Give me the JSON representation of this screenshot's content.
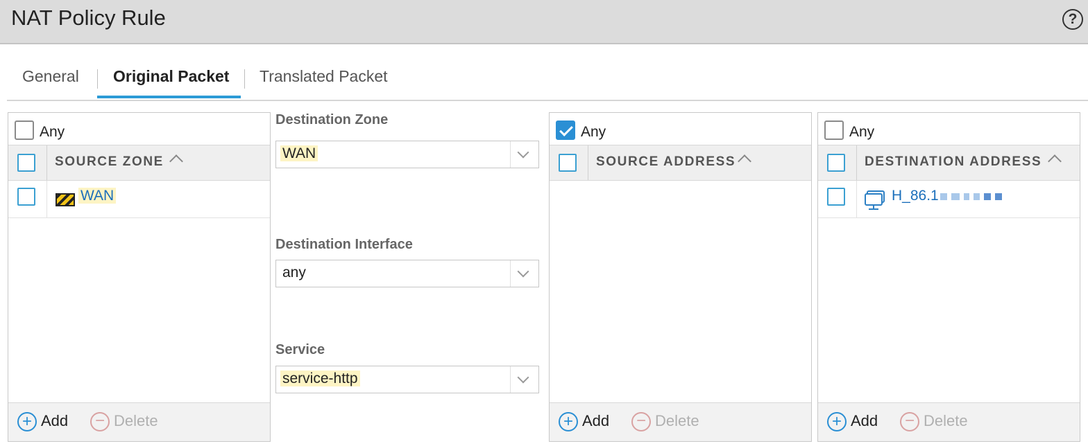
{
  "window": {
    "title": "NAT Policy Rule",
    "help_glyph": "?"
  },
  "tabs": [
    {
      "label": "General",
      "active": false
    },
    {
      "label": "Original Packet",
      "active": true
    },
    {
      "label": "Translated Packet",
      "active": false
    }
  ],
  "source_zone": {
    "any_label": "Any",
    "any_checked": false,
    "column": "SOURCE ZONE",
    "items": [
      {
        "name": "WAN",
        "icon": "zone-icon"
      }
    ],
    "add_label": "Add",
    "delete_label": "Delete"
  },
  "destination_zone": {
    "label": "Destination Zone",
    "value": "WAN"
  },
  "destination_interface": {
    "label": "Destination Interface",
    "value": "any"
  },
  "service": {
    "label": "Service",
    "value": "service-http"
  },
  "source_address": {
    "any_label": "Any",
    "any_checked": true,
    "column": "SOURCE ADDRESS",
    "items": [],
    "add_label": "Add",
    "delete_label": "Delete"
  },
  "destination_address": {
    "any_label": "Any",
    "any_checked": false,
    "column": "DESTINATION ADDRESS",
    "items": [
      {
        "name": "H_86.1",
        "icon": "address-object-icon",
        "redacted": true
      }
    ],
    "add_label": "Add",
    "delete_label": "Delete"
  },
  "colors": {
    "accent": "#2d9bd6",
    "link": "#1b6fbb",
    "highlight": "#fdf4c4",
    "checkbox": "#2a8fd4"
  }
}
